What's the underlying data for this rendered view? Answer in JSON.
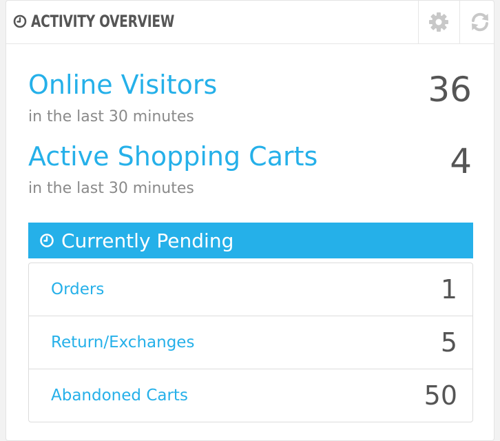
{
  "header": {
    "title": "ACTIVITY OVERVIEW",
    "title_icon": "clock-icon",
    "tools": [
      {
        "name": "configure",
        "icon": "gear-icon"
      },
      {
        "name": "refresh",
        "icon": "refresh-icon"
      }
    ]
  },
  "stats": [
    {
      "label": "Online Visitors",
      "sub": "in the last 30 minutes",
      "value": "36"
    },
    {
      "label": "Active Shopping Carts",
      "sub": "in the last 30 minutes",
      "value": "4"
    }
  ],
  "pending": {
    "title": "Currently Pending",
    "icon": "clock-icon",
    "items": [
      {
        "label": "Orders",
        "value": "1"
      },
      {
        "label": "Return/Exchanges",
        "value": "5"
      },
      {
        "label": "Abandoned Carts",
        "value": "50"
      }
    ]
  },
  "colors": {
    "accent": "#25b0e9",
    "text_dark": "#555555",
    "text_muted": "#8a8a8a",
    "icon_gray": "#c8c8c8"
  }
}
